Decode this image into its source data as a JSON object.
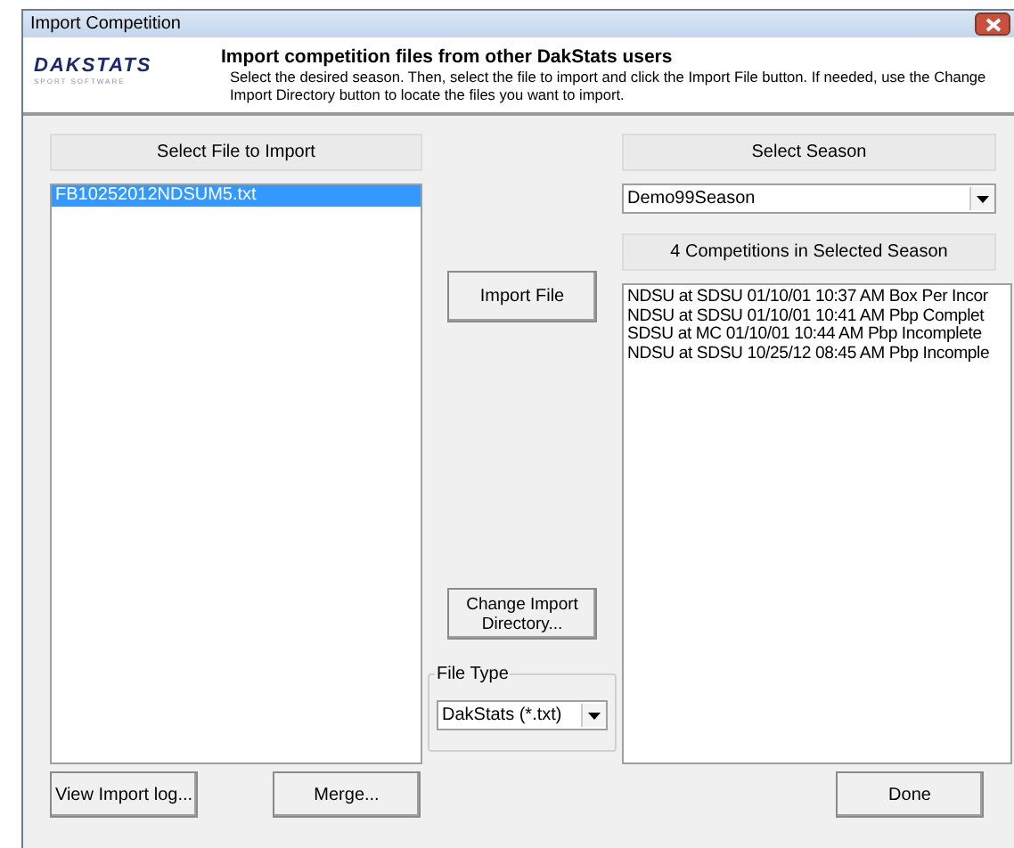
{
  "window": {
    "title": "Import Competition"
  },
  "header": {
    "logo": "DAKSTATS",
    "logo_tagline": "SPORT SOFTWARE",
    "heading": "Import competition files from other DakStats users",
    "description": "Select the desired season. Then, select the file to import and click the Import File button. If needed, use the Change Import Directory button to locate the files you want to import."
  },
  "file_panel": {
    "title": "Select File to Import",
    "files": [
      {
        "name": "FB10252012NDSUM5.txt",
        "selected": true
      }
    ]
  },
  "season_panel": {
    "title": "Select Season",
    "season": "Demo99Season",
    "competitions_title": "4 Competitions in Selected Season",
    "competitions": [
      {
        "text": "NDSU at SDSU 01/10/01 10:37 AM  Box Per Incor"
      },
      {
        "text": "NDSU at SDSU 01/10/01 10:41 AM  Pbp Complet"
      },
      {
        "text": "SDSU at MC 01/10/01 10:44 AM  Pbp Incomplete"
      },
      {
        "text": "NDSU at SDSU 10/25/12 08:45 AM  Pbp Incomple"
      }
    ]
  },
  "import_button": "Import File",
  "change_dir_button": "Change Import Directory...",
  "file_type": {
    "legend": "File Type",
    "value": "DakStats (*.txt)"
  },
  "buttons": {
    "view_log": "View Import log...",
    "merge": "Merge...",
    "done": "Done"
  }
}
